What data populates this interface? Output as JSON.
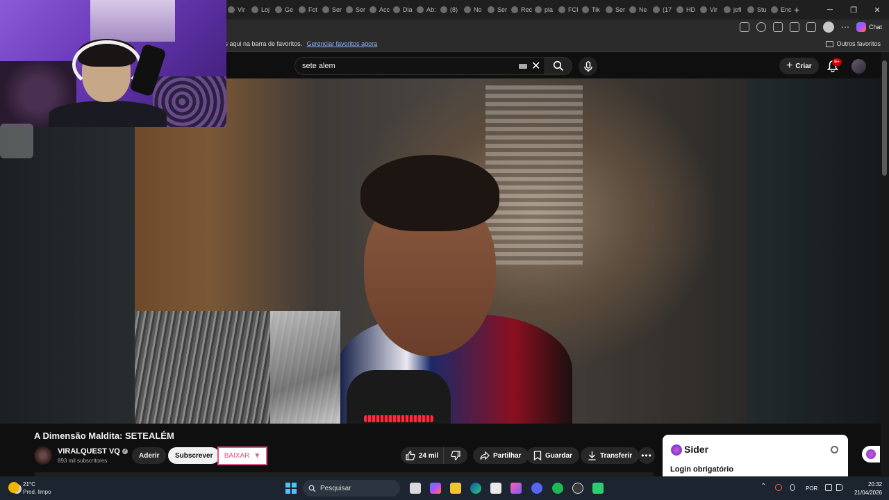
{
  "browser": {
    "tabs": [
      "Vir",
      "Loj",
      "Ge",
      "Fot",
      "Ser",
      "Ser",
      "Acc",
      "Dia",
      "Ab:",
      "(8)",
      "No",
      "Ser",
      "Rec",
      "pla",
      "FCI",
      "Tik",
      "Ser",
      "Ne",
      "(17",
      "HD",
      "Vir",
      "jefi",
      "Stu",
      "Enc"
    ],
    "copilot_label": "Chat",
    "favbar_hint": "tos aqui na barra de favoritos.",
    "favbar_link": "Gerenciar favoritos agora",
    "other_favorites": "Outros favoritos",
    "window_controls": [
      "─",
      "❐",
      "✕"
    ]
  },
  "youtube": {
    "search_value": "sete alem",
    "create_label": "Criar",
    "notif_badge": "9+",
    "video_title": "A Dimensão Maldita: SETEALÉM",
    "channel_name": "VIRALQUEST VQ",
    "subscribers": "893 mil subscritores",
    "join_label": "Aderir",
    "subscribe_label": "Subscrever",
    "download_ext_label": "BAIXAR",
    "like_count": "24 mil",
    "share_label": "Partilhar",
    "save_label": "Guardar",
    "transfer_label": "Transferir"
  },
  "sider": {
    "title": "Sider",
    "login_text": "Login obrigatório"
  },
  "taskbar": {
    "temperature": "21°C",
    "weather": "Pred. limpo",
    "search_placeholder": "Pesquisar",
    "language": "POR",
    "time": "20:32",
    "date": "21/04/2026"
  },
  "colors": {
    "yt_bg": "#0f0f0f",
    "accent_red": "#cc0000",
    "baixar_pink": "#e0558a",
    "taskbar": "#1c2430"
  }
}
